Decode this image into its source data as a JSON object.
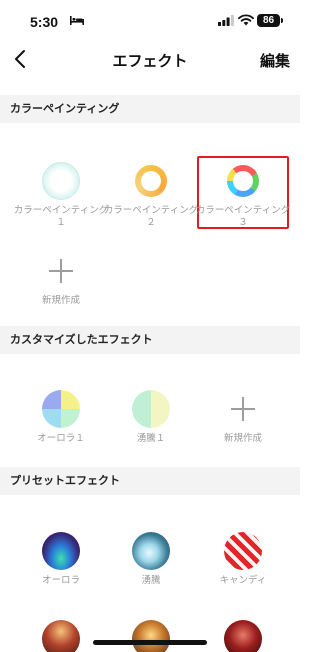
{
  "status": {
    "time": "5:30",
    "battery": "86"
  },
  "nav": {
    "title": "エフェクト",
    "edit_label": "編集"
  },
  "sections": {
    "color_painting": {
      "title": "カラーペインティング",
      "items": [
        {
          "label": "カラーペインティング１"
        },
        {
          "label": "カラーペインティング２"
        },
        {
          "label": "カラーペインティング３"
        }
      ],
      "new_label": "新規作成"
    },
    "custom": {
      "title": "カスタマイズしたエフェクト",
      "items": [
        {
          "label": "オーロラ１"
        },
        {
          "label": "湧騰１"
        }
      ],
      "new_label": "新規作成"
    },
    "preset": {
      "title": "プリセットエフェクト",
      "items": [
        {
          "label": "オーロラ"
        },
        {
          "label": "湧騰"
        },
        {
          "label": "キャンディ"
        }
      ]
    }
  },
  "colors": {
    "selection": "#e31b23",
    "section_bg": "#f3f3f3",
    "label": "#9a9a9a"
  }
}
